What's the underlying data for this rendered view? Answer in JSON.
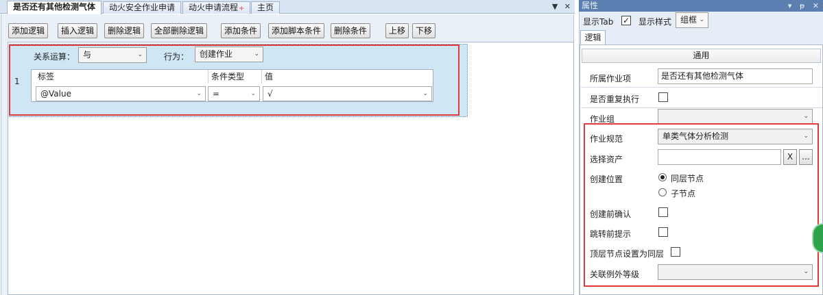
{
  "tabs": {
    "items": [
      {
        "label": "是否还有其他检测气体"
      },
      {
        "label": "动火安全作业申请"
      },
      {
        "label": "动火申请流程"
      },
      {
        "label": "主页"
      }
    ],
    "modified_mark": "+",
    "tools": [
      "▼",
      "✕"
    ]
  },
  "toolbar": {
    "add_logic": "添加逻辑",
    "insert_logic": "插入逻辑",
    "delete_logic": "删除逻辑",
    "delete_all_logic": "全部删除逻辑",
    "add_condition": "添加条件",
    "add_script_condition": "添加脚本条件",
    "delete_condition": "删除条件",
    "move_up": "上移",
    "move_down": "下移"
  },
  "logic": {
    "row_number": "1",
    "relation_label": "关系运算：",
    "relation_value": "与",
    "action_label": "行为：",
    "action_value": "创建作业",
    "grid": {
      "columns": [
        "标签",
        "条件类型",
        "值"
      ],
      "row": {
        "tag": "@Value",
        "condition_type": "=",
        "value": "√"
      }
    }
  },
  "properties": {
    "title": "属性",
    "title_tools": [
      "▾",
      "ᵽ",
      "✕"
    ],
    "show_tab_label": "显示Tab",
    "show_tab_checked": "✓",
    "show_style_label": "显示样式",
    "show_style_value": "组框",
    "tab_label": "逻辑",
    "section_header": "通用",
    "fields": {
      "owner_item_label": "所属作业项",
      "owner_item_value": "是否还有其他检测气体",
      "repeat_label": "是否重复执行",
      "group_label": "作业组",
      "spec_label": "作业规范",
      "spec_value": "单类气体分析检测",
      "asset_label": "选择资产",
      "asset_clear": "X",
      "asset_browse": "...",
      "position_label": "创建位置",
      "position_opt1": "同层节点",
      "position_opt2": "子节点",
      "confirm_label": "创建前确认",
      "jump_label": "跳转前提示",
      "top_node_label": "顶层节点设置为同层",
      "exception_label": "关联例外等级"
    }
  },
  "colors": {
    "selection_outline": "#e03a3a",
    "panel_title": "#5b7fb0",
    "logic_block": "#cfe7f5"
  }
}
